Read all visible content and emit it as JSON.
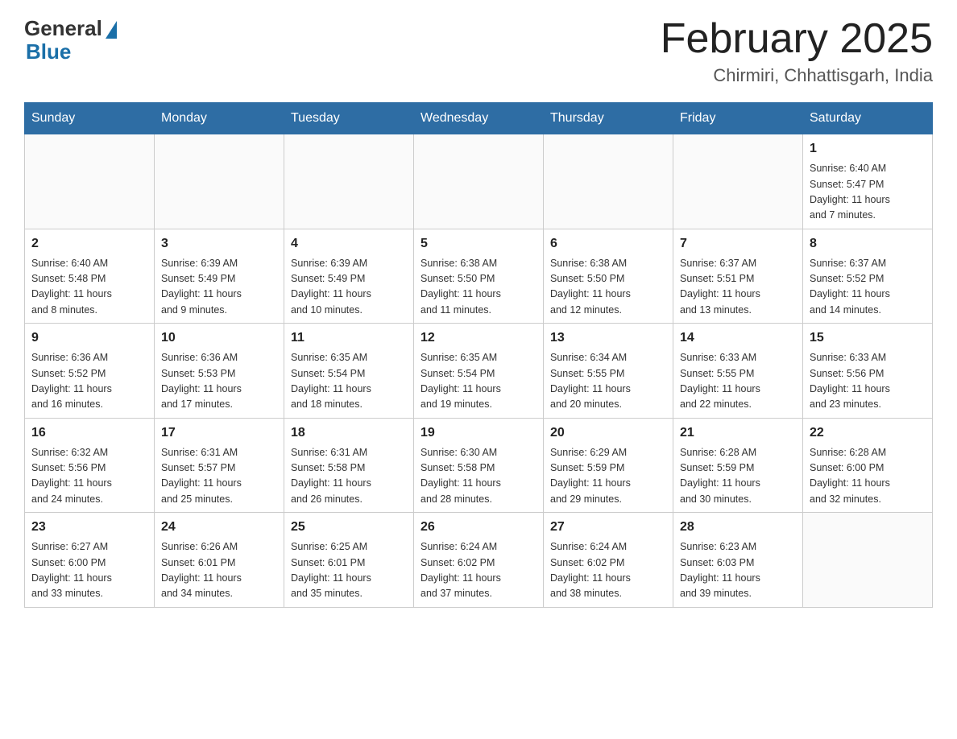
{
  "header": {
    "logo": {
      "general_text": "General",
      "blue_text": "Blue"
    },
    "title": "February 2025",
    "location": "Chirmiri, Chhattisgarh, India"
  },
  "days_of_week": [
    "Sunday",
    "Monday",
    "Tuesday",
    "Wednesday",
    "Thursday",
    "Friday",
    "Saturday"
  ],
  "weeks": [
    {
      "days": [
        {
          "num": "",
          "info": ""
        },
        {
          "num": "",
          "info": ""
        },
        {
          "num": "",
          "info": ""
        },
        {
          "num": "",
          "info": ""
        },
        {
          "num": "",
          "info": ""
        },
        {
          "num": "",
          "info": ""
        },
        {
          "num": "1",
          "info": "Sunrise: 6:40 AM\nSunset: 5:47 PM\nDaylight: 11 hours\nand 7 minutes."
        }
      ]
    },
    {
      "days": [
        {
          "num": "2",
          "info": "Sunrise: 6:40 AM\nSunset: 5:48 PM\nDaylight: 11 hours\nand 8 minutes."
        },
        {
          "num": "3",
          "info": "Sunrise: 6:39 AM\nSunset: 5:49 PM\nDaylight: 11 hours\nand 9 minutes."
        },
        {
          "num": "4",
          "info": "Sunrise: 6:39 AM\nSunset: 5:49 PM\nDaylight: 11 hours\nand 10 minutes."
        },
        {
          "num": "5",
          "info": "Sunrise: 6:38 AM\nSunset: 5:50 PM\nDaylight: 11 hours\nand 11 minutes."
        },
        {
          "num": "6",
          "info": "Sunrise: 6:38 AM\nSunset: 5:50 PM\nDaylight: 11 hours\nand 12 minutes."
        },
        {
          "num": "7",
          "info": "Sunrise: 6:37 AM\nSunset: 5:51 PM\nDaylight: 11 hours\nand 13 minutes."
        },
        {
          "num": "8",
          "info": "Sunrise: 6:37 AM\nSunset: 5:52 PM\nDaylight: 11 hours\nand 14 minutes."
        }
      ]
    },
    {
      "days": [
        {
          "num": "9",
          "info": "Sunrise: 6:36 AM\nSunset: 5:52 PM\nDaylight: 11 hours\nand 16 minutes."
        },
        {
          "num": "10",
          "info": "Sunrise: 6:36 AM\nSunset: 5:53 PM\nDaylight: 11 hours\nand 17 minutes."
        },
        {
          "num": "11",
          "info": "Sunrise: 6:35 AM\nSunset: 5:54 PM\nDaylight: 11 hours\nand 18 minutes."
        },
        {
          "num": "12",
          "info": "Sunrise: 6:35 AM\nSunset: 5:54 PM\nDaylight: 11 hours\nand 19 minutes."
        },
        {
          "num": "13",
          "info": "Sunrise: 6:34 AM\nSunset: 5:55 PM\nDaylight: 11 hours\nand 20 minutes."
        },
        {
          "num": "14",
          "info": "Sunrise: 6:33 AM\nSunset: 5:55 PM\nDaylight: 11 hours\nand 22 minutes."
        },
        {
          "num": "15",
          "info": "Sunrise: 6:33 AM\nSunset: 5:56 PM\nDaylight: 11 hours\nand 23 minutes."
        }
      ]
    },
    {
      "days": [
        {
          "num": "16",
          "info": "Sunrise: 6:32 AM\nSunset: 5:56 PM\nDaylight: 11 hours\nand 24 minutes."
        },
        {
          "num": "17",
          "info": "Sunrise: 6:31 AM\nSunset: 5:57 PM\nDaylight: 11 hours\nand 25 minutes."
        },
        {
          "num": "18",
          "info": "Sunrise: 6:31 AM\nSunset: 5:58 PM\nDaylight: 11 hours\nand 26 minutes."
        },
        {
          "num": "19",
          "info": "Sunrise: 6:30 AM\nSunset: 5:58 PM\nDaylight: 11 hours\nand 28 minutes."
        },
        {
          "num": "20",
          "info": "Sunrise: 6:29 AM\nSunset: 5:59 PM\nDaylight: 11 hours\nand 29 minutes."
        },
        {
          "num": "21",
          "info": "Sunrise: 6:28 AM\nSunset: 5:59 PM\nDaylight: 11 hours\nand 30 minutes."
        },
        {
          "num": "22",
          "info": "Sunrise: 6:28 AM\nSunset: 6:00 PM\nDaylight: 11 hours\nand 32 minutes."
        }
      ]
    },
    {
      "days": [
        {
          "num": "23",
          "info": "Sunrise: 6:27 AM\nSunset: 6:00 PM\nDaylight: 11 hours\nand 33 minutes."
        },
        {
          "num": "24",
          "info": "Sunrise: 6:26 AM\nSunset: 6:01 PM\nDaylight: 11 hours\nand 34 minutes."
        },
        {
          "num": "25",
          "info": "Sunrise: 6:25 AM\nSunset: 6:01 PM\nDaylight: 11 hours\nand 35 minutes."
        },
        {
          "num": "26",
          "info": "Sunrise: 6:24 AM\nSunset: 6:02 PM\nDaylight: 11 hours\nand 37 minutes."
        },
        {
          "num": "27",
          "info": "Sunrise: 6:24 AM\nSunset: 6:02 PM\nDaylight: 11 hours\nand 38 minutes."
        },
        {
          "num": "28",
          "info": "Sunrise: 6:23 AM\nSunset: 6:03 PM\nDaylight: 11 hours\nand 39 minutes."
        },
        {
          "num": "",
          "info": ""
        }
      ]
    }
  ]
}
